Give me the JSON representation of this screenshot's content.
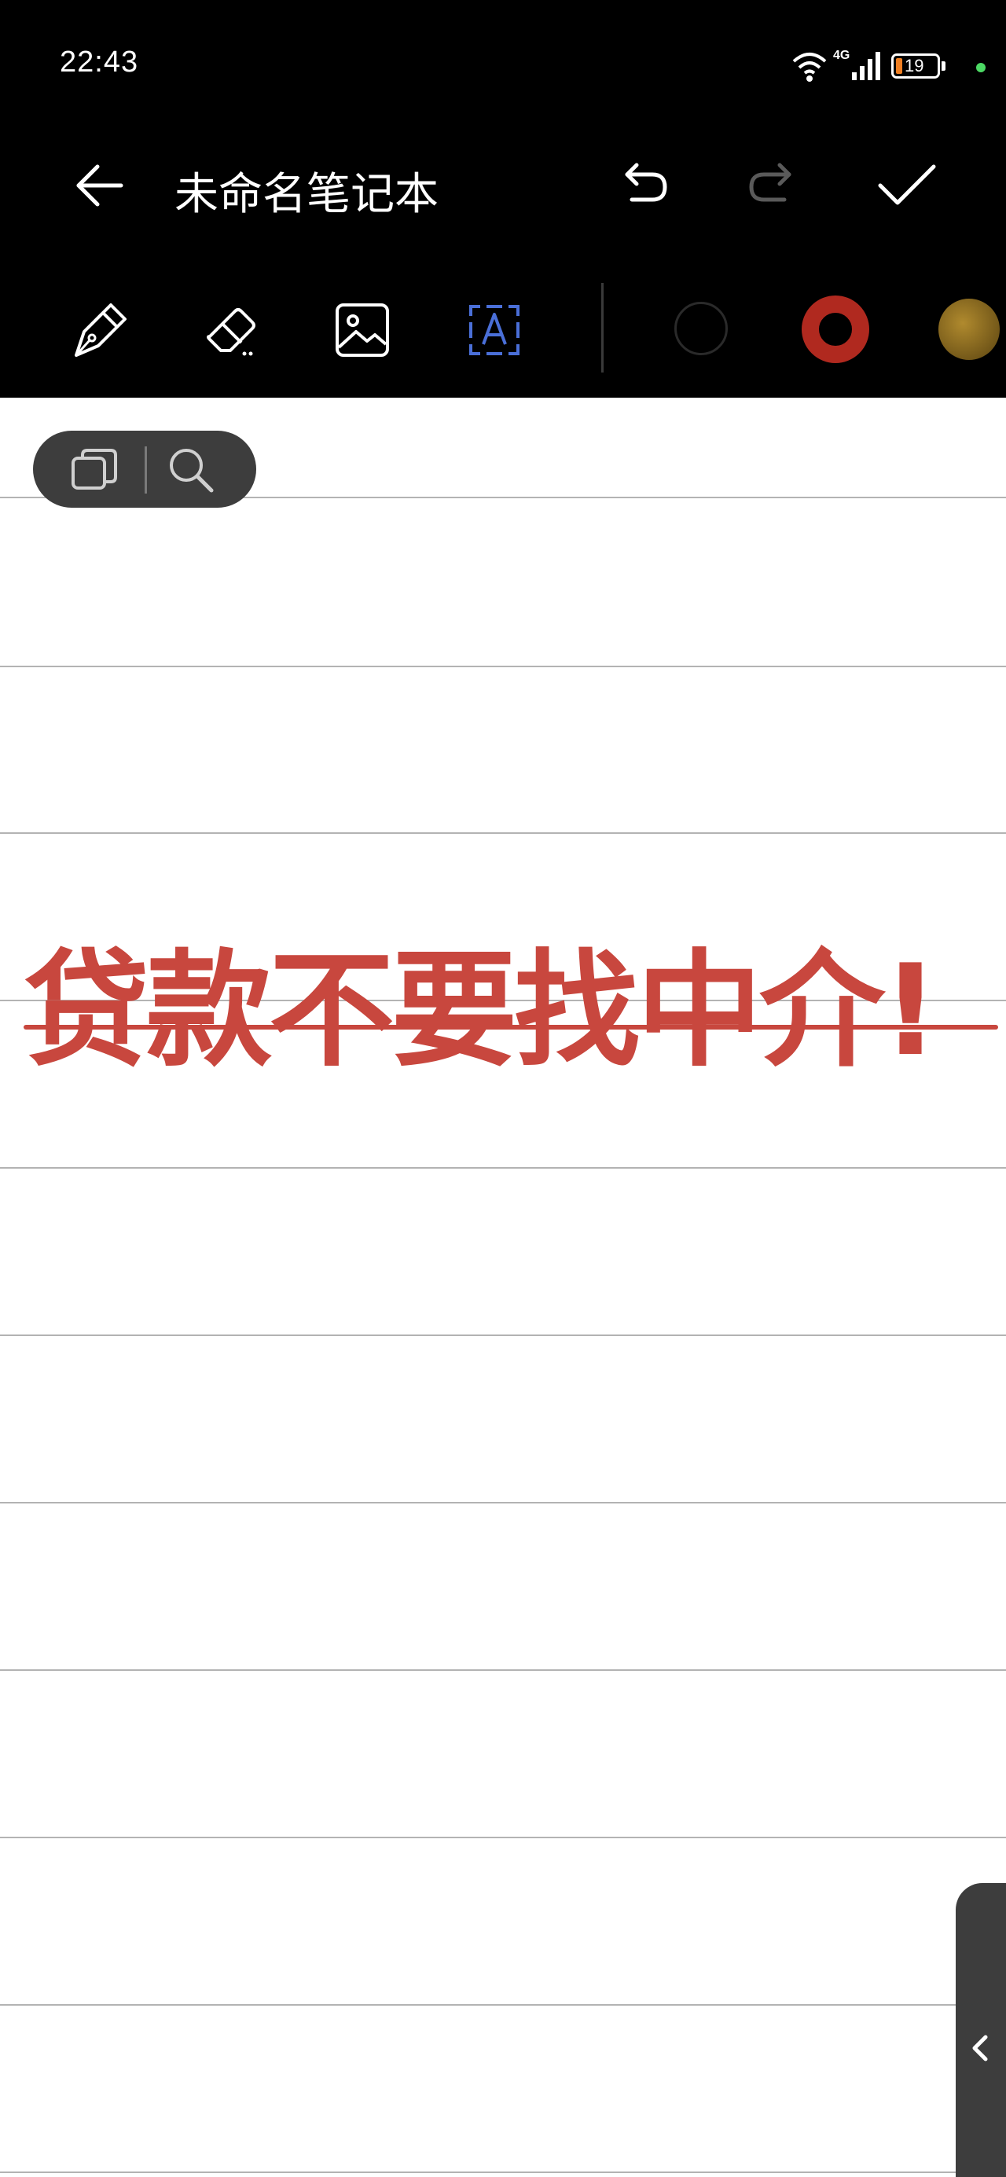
{
  "status_bar": {
    "time": "22:43",
    "network": "4G",
    "battery": "19"
  },
  "toolbar": {
    "title": "未命名笔记本",
    "back_icon": "arrow-left-icon",
    "undo_icon": "undo-icon",
    "redo_icon": "redo-icon",
    "confirm_icon": "checkmark-icon"
  },
  "tools": [
    {
      "name": "pen",
      "icon": "pen-icon",
      "active": false
    },
    {
      "name": "eraser",
      "icon": "eraser-icon",
      "active": false
    },
    {
      "name": "image",
      "icon": "image-icon",
      "active": false
    },
    {
      "name": "text",
      "icon": "text-box-icon",
      "active": true
    }
  ],
  "colors": {
    "accent": "#4a6fd8",
    "swatch_black": "#111111",
    "swatch_red": "#b0291f",
    "swatch_gold": "#8a6a1e",
    "ink": "#c8473e"
  },
  "note": {
    "text": "贷款不要找中介!"
  },
  "floating_pill": {
    "left_icon": "pages-icon",
    "right_icon": "search-icon"
  },
  "side_tab_icon": "chevron-left-icon"
}
